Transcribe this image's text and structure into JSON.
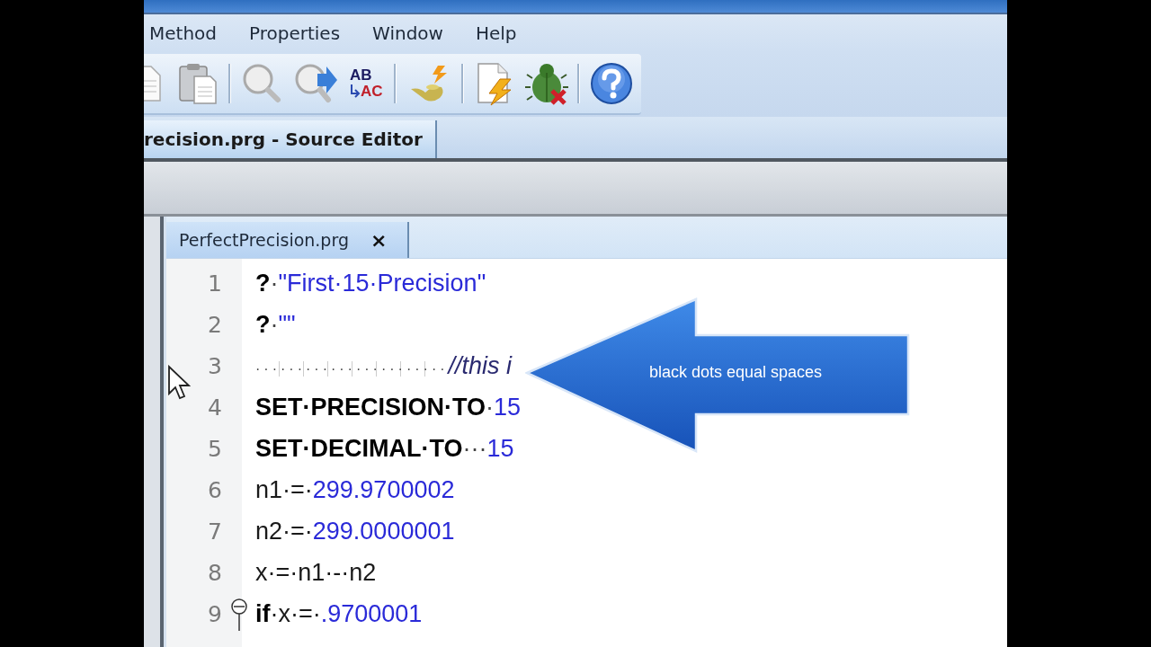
{
  "menu": [
    "Method",
    "Properties",
    "Window",
    "Help"
  ],
  "toolbar": [
    {
      "kind": "document"
    },
    {
      "kind": "clipboard"
    },
    {
      "kind": "separator"
    },
    {
      "kind": "find"
    },
    {
      "kind": "find-next"
    },
    {
      "kind": "replace",
      "top": "AB",
      "bottom": "AC"
    },
    {
      "kind": "separator"
    },
    {
      "kind": "wizard"
    },
    {
      "kind": "separator"
    },
    {
      "kind": "new-program"
    },
    {
      "kind": "debug"
    },
    {
      "kind": "separator"
    },
    {
      "kind": "help"
    }
  ],
  "document_tab": {
    "label": "recision.prg - Source Editor"
  },
  "editor": {
    "tab": {
      "label": "PerfectPrecision.prg",
      "close": "×"
    },
    "lines": [
      {
        "number": "1",
        "fold": false,
        "tokens": [
          {
            "kind": "keyword",
            "text": "?"
          },
          {
            "kind": "space",
            "text": "·"
          },
          {
            "kind": "string",
            "text": "\"First·15·Precision\""
          }
        ]
      },
      {
        "number": "2",
        "fold": false,
        "tokens": [
          {
            "kind": "keyword",
            "text": "?"
          },
          {
            "kind": "space",
            "text": "·"
          },
          {
            "kind": "string",
            "text": "\"\""
          }
        ]
      },
      {
        "number": "3",
        "fold": false,
        "tokens": [
          {
            "kind": "indent",
            "text": "·······················"
          },
          {
            "kind": "comment",
            "text": "//this i"
          }
        ]
      },
      {
        "number": "4",
        "fold": false,
        "tokens": [
          {
            "kind": "keyword",
            "text": "SET·PRECISION·TO"
          },
          {
            "kind": "space",
            "text": "·"
          },
          {
            "kind": "number",
            "text": "15"
          }
        ]
      },
      {
        "number": "5",
        "fold": false,
        "tokens": [
          {
            "kind": "keyword",
            "text": "SET·DECIMAL·TO"
          },
          {
            "kind": "space",
            "text": "···"
          },
          {
            "kind": "number",
            "text": "15"
          }
        ]
      },
      {
        "number": "6",
        "fold": false,
        "tokens": [
          {
            "kind": "plain",
            "text": "n1·=·"
          },
          {
            "kind": "number",
            "text": "299.9700002"
          }
        ]
      },
      {
        "number": "7",
        "fold": false,
        "tokens": [
          {
            "kind": "plain",
            "text": "n2·=·"
          },
          {
            "kind": "number",
            "text": "299.0000001"
          }
        ]
      },
      {
        "number": "8",
        "fold": false,
        "tokens": [
          {
            "kind": "plain",
            "text": "x·=·n1·-·n2"
          }
        ]
      },
      {
        "number": "9",
        "fold": true,
        "tokens": [
          {
            "kind": "keyword",
            "text": "if"
          },
          {
            "kind": "plain",
            "text": "·x·=·"
          },
          {
            "kind": "number",
            "text": ".9700001"
          }
        ]
      }
    ]
  },
  "callout": {
    "text": "black dots equal spaces"
  }
}
